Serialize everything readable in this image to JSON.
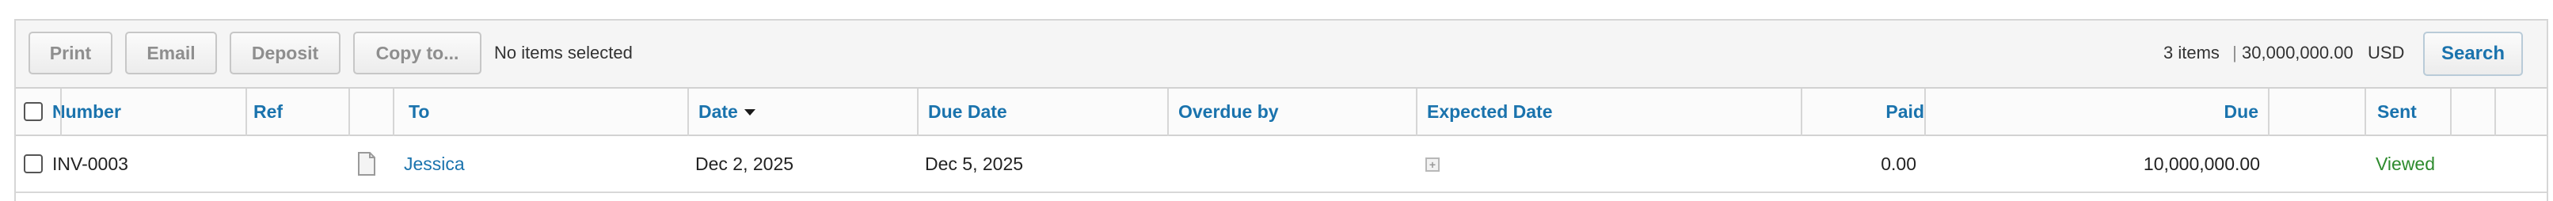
{
  "toolbar": {
    "buttons": {
      "print": "Print",
      "email": "Email",
      "deposit": "Deposit",
      "copy_to": "Copy to..."
    },
    "selection_status": "No items selected",
    "items_summary": "3 items",
    "total_amount": "30,000,000.00",
    "currency": "USD",
    "search_label": "Search"
  },
  "table": {
    "columns": {
      "number": "Number",
      "ref": "Ref",
      "to": "To",
      "date": "Date",
      "due_date": "Due Date",
      "overdue_by": "Overdue by",
      "expected_date": "Expected Date",
      "paid": "Paid",
      "due": "Due",
      "sent": "Sent"
    },
    "sort": {
      "column": "Date",
      "direction": "descending"
    },
    "rows": [
      {
        "number": "INV-0003",
        "ref": "",
        "to": "Jessica",
        "date": "Dec 2, 2025",
        "due_date": "Dec 5, 2025",
        "overdue_by": "",
        "expected_date": "",
        "paid": "0.00",
        "due": "10,000,000.00",
        "sent": "Viewed"
      }
    ]
  },
  "colors": {
    "link": "#1a73ad",
    "sent_viewed": "#2e8b2e",
    "toolbar_bg": "#f5f5f5",
    "disabled_text": "#8e8e8e"
  },
  "icons": {
    "attachment": "document-icon",
    "expected_date_add": "plus-box-icon",
    "sort": "caret-down-icon"
  }
}
